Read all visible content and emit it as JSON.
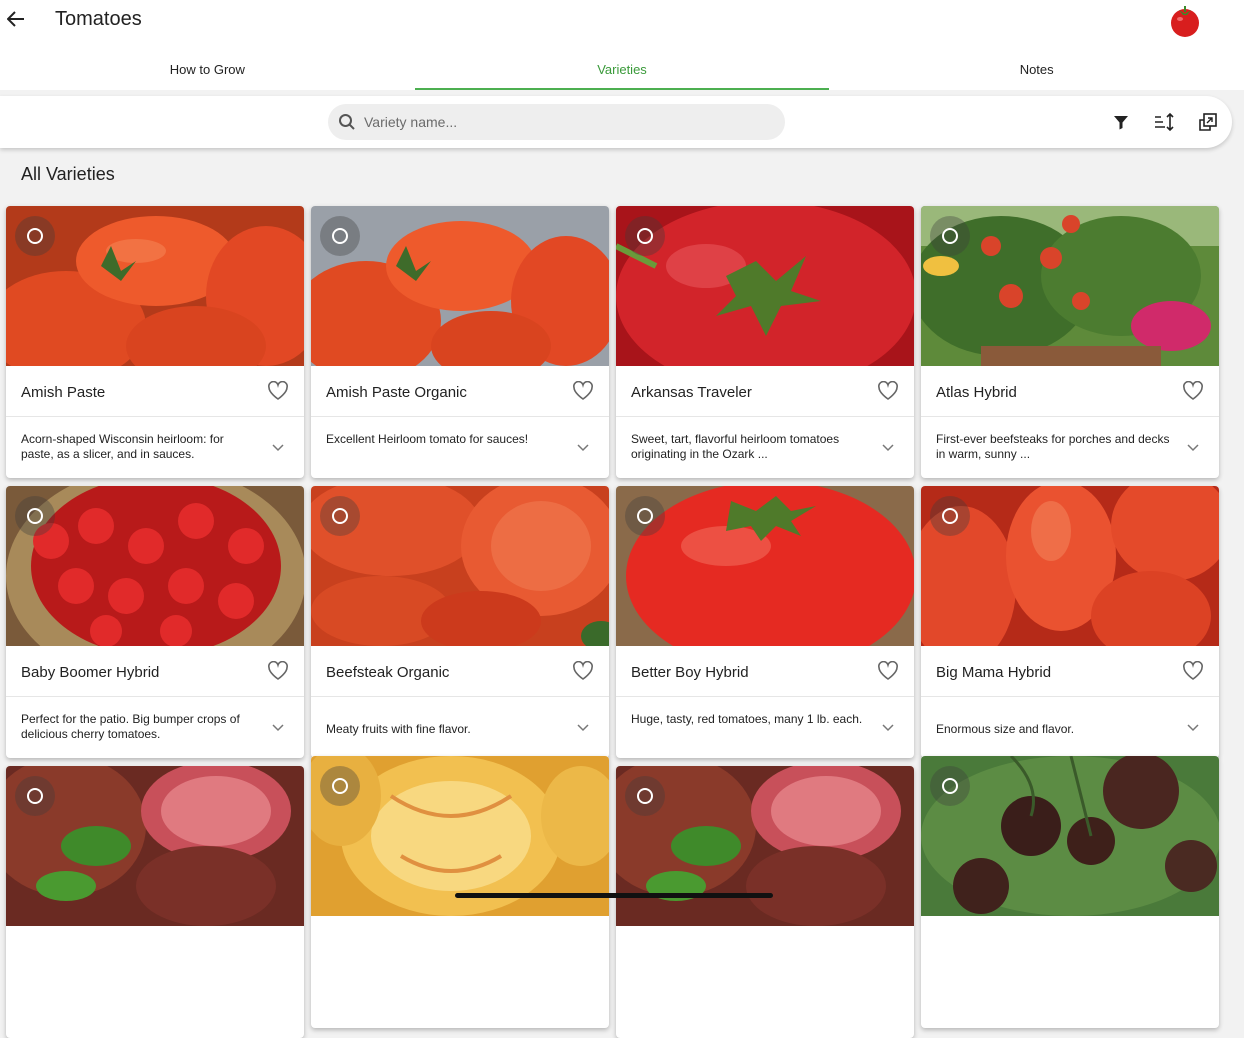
{
  "header": {
    "title": "Tomatoes",
    "back_icon": "arrow-left-icon",
    "logo_icon": "tomato-icon"
  },
  "tabs": [
    {
      "label": "How to Grow",
      "active": false
    },
    {
      "label": "Varieties",
      "active": true
    },
    {
      "label": "Notes",
      "active": false
    }
  ],
  "search": {
    "placeholder": "Variety name...",
    "value": ""
  },
  "toolbar": {
    "filter_icon": "filter-icon",
    "sort_icon": "sort-icon",
    "compare_icon": "compare-icon"
  },
  "section_title": "All Varieties",
  "colors": {
    "accent_green": "#4caf50",
    "tab_active_text": "#3a9a3a"
  },
  "varieties": [
    {
      "name": "Amish Paste",
      "description": "Acorn-shaped Wisconsin heirloom: for paste, as a slicer, and in sauces."
    },
    {
      "name": "Amish Paste Organic",
      "description": "Excellent Heirloom tomato for sauces!"
    },
    {
      "name": "Arkansas Traveler",
      "description": "Sweet, tart, flavorful heirloom tomatoes originating in the Ozark ..."
    },
    {
      "name": "Atlas Hybrid",
      "description": "First-ever beefsteaks for porches and decks in warm, sunny ..."
    },
    {
      "name": "Baby Boomer Hybrid",
      "description": "Perfect for the patio. Big bumper crops of delicious cherry tomatoes."
    },
    {
      "name": "Beefsteak Organic",
      "description": "Meaty fruits with fine flavor."
    },
    {
      "name": "Better Boy  Hybrid",
      "description": "Huge, tasty, red tomatoes, many 1 lb. each."
    },
    {
      "name": "Big Mama Hybrid",
      "description": "Enormous size and flavor."
    },
    {
      "name": "",
      "description": ""
    },
    {
      "name": "",
      "description": ""
    },
    {
      "name": "",
      "description": ""
    },
    {
      "name": "",
      "description": ""
    }
  ]
}
